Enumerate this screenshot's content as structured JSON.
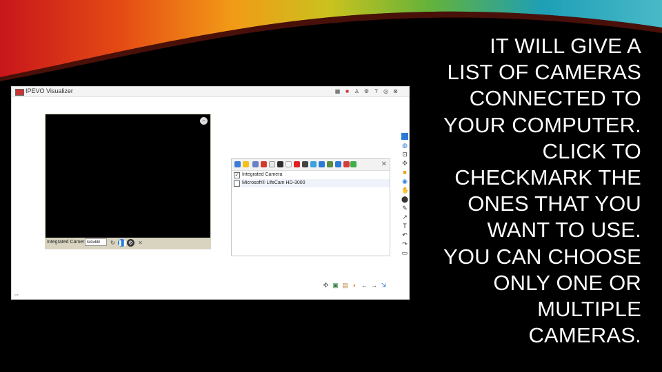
{
  "slide": {
    "text": "IT WILL GIVE A\nLIST OF CAMERAS\nCONNECTED TO\nYOUR COMPUTER.\nCLICK TO\nCHECKMARK THE\nONES THAT YOU\nWANT TO USE.\nYOU CAN CHOOSE\nONLY ONE OR\nMULTIPLE\nCAMERAS."
  },
  "app": {
    "name": "IPEVO Visualizer"
  },
  "camera_panel": {
    "source_label": "Integrated Camera",
    "resolution": "640x480"
  },
  "camera_list": {
    "cameras": [
      {
        "label": "Integrated Camera",
        "checked": true
      },
      {
        "label": "Microsoft® LifeCam HD-3000",
        "checked": false
      }
    ]
  },
  "icons": {
    "window_buttons": [
      "grid-icon",
      "camera-icon",
      "person-icon",
      "settings-icon",
      "help-icon",
      "close-icon"
    ],
    "side_tools": [
      "blue-square-icon",
      "globe-icon",
      "settings-icon",
      "move-icon",
      "folder-icon",
      "stamp-icon",
      "hand-icon",
      "pen-icon",
      "eraser-icon",
      "line-icon",
      "text-icon",
      "undo-icon",
      "redo-icon",
      "page-icon"
    ],
    "bottom_tools": [
      "move-icon",
      "split-icon",
      "book-icon",
      "chart-icon",
      "back-icon",
      "forward-icon",
      "export-icon"
    ]
  },
  "colors": {
    "background": "#000000",
    "text": "#ffffff",
    "panel": "#d9d4c0",
    "accent": "#2b7ad8"
  }
}
